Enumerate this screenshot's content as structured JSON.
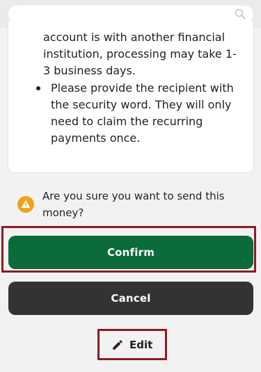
{
  "search": {
    "icon": "search-icon"
  },
  "info": {
    "partial_text": "account is with another financial institution, processing may take 1-3 business days.",
    "bullet_text": "Please provide the recipient with the security word. They will only need to claim the recurring payments once."
  },
  "warning": {
    "icon": "warning-icon",
    "color": "#f0a31a",
    "text": "Are you sure you want to send this money?"
  },
  "actions": {
    "confirm_label": "Confirm",
    "confirm_color": "#0b6b3a",
    "cancel_label": "Cancel",
    "cancel_color": "#333333",
    "edit_label": "Edit",
    "edit_icon": "pencil-icon"
  },
  "highlight_color": "#8b1c24"
}
